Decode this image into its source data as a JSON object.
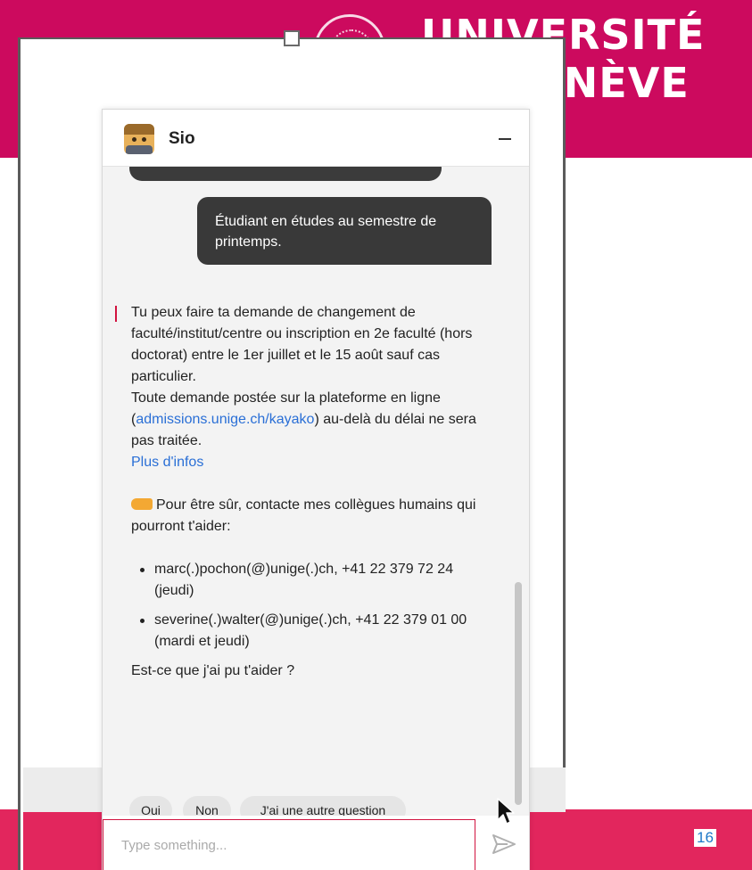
{
  "slide": {
    "university_name": "UNIVERSITÉ\nDE GENÈVE",
    "seal_text": "15 59",
    "page_number": "16"
  },
  "chat": {
    "bot_name": "Sio",
    "user_message": "Étudiant en études au semestre de printemps.",
    "bot_message": {
      "paragraph1": "Tu peux faire ta demande de changement de faculté/institut/centre ou inscription en 2e faculté (hors doctorat) entre le 1er juillet et le 15 août sauf cas particulier.",
      "paragraph2_before": "Toute demande postée sur la plateforme en ligne (",
      "paragraph2_link": "admissions.unige.ch/kayako",
      "paragraph2_after": ") au-delà du délai ne sera pas traitée.",
      "more_info_link": "Plus d'infos",
      "contact_intro": "Pour être sûr, contacte mes collègues humains qui pourront t'aider:",
      "contacts": [
        "marc(.)pochon(@)unige(.)ch, +41 22 379 72 24 (jeudi)",
        "severine(.)walter(@)unige(.)ch, +41 22 379 01 00 (mardi et jeudi)"
      ],
      "question": "Est-ce que j'ai pu t'aider ?"
    },
    "quick_replies": [
      "Oui",
      "Non",
      "J'ai une autre question"
    ],
    "input": {
      "placeholder": "Type something..."
    }
  },
  "colors": {
    "brand_magenta": "#cc0a5e",
    "accent_red": "#d1123f",
    "link_blue": "#2a6fd6",
    "user_bubble": "#393939"
  },
  "icons": [
    "university-seal-icon",
    "bot-avatar-icon",
    "minimize-icon",
    "pointing-hand-icon",
    "send-icon",
    "mouse-cursor-icon"
  ]
}
